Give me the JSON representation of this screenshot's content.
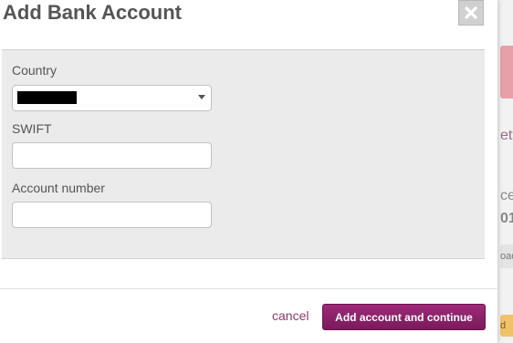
{
  "dialog": {
    "title": "Add Bank Account",
    "close_icon": "close-icon",
    "country": {
      "label": "Country",
      "value": ""
    },
    "swift": {
      "label": "SWIFT",
      "value": ""
    },
    "account_number": {
      "label": "Account number",
      "value": ""
    },
    "cancel_label": "cancel",
    "submit_label": "Add account and continue"
  },
  "background": {
    "text1": "ettings",
    "text2": "ce",
    "text3": "01",
    "chip1": "oad",
    "chip2": "d"
  },
  "colors": {
    "accent": "#8b2468",
    "cancel_link": "#8b3a6f",
    "body_panel": "#ebebeb"
  }
}
